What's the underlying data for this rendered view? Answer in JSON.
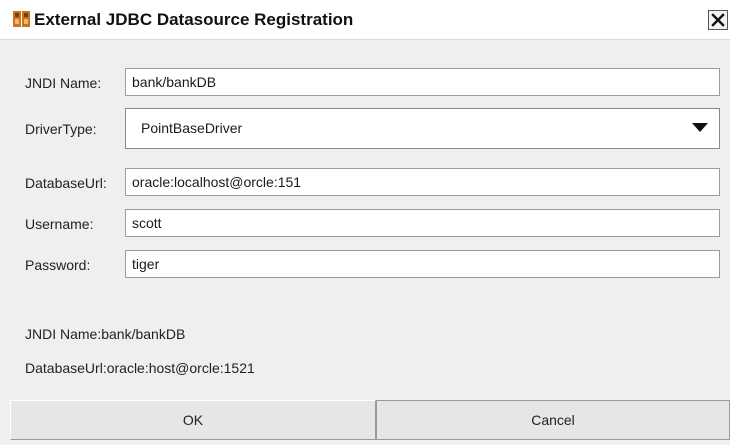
{
  "window": {
    "title": "External JDBC Datasource Registration",
    "app_icon": "java-cup-icon",
    "close_icon": "close-icon"
  },
  "form": {
    "jndi_name": {
      "label": "JNDI Name:",
      "value": "bank/bankDB"
    },
    "driver_type": {
      "label": "DriverType:",
      "selected": "PointBaseDriver",
      "icon": "chevron-down-icon"
    },
    "database_url": {
      "label": "DatabaseUrl:",
      "value": "oracle:localhost@orcle:151"
    },
    "username": {
      "label": "Username:",
      "value": "scott"
    },
    "password": {
      "label": "Password:",
      "value": "tiger"
    }
  },
  "summary": {
    "jndi_line": "JNDI Name:bank/bankDB",
    "url_line": "DatabaseUrl:oracle:host@orcle:1521"
  },
  "buttons": {
    "ok": "OK",
    "cancel": "Cancel"
  }
}
